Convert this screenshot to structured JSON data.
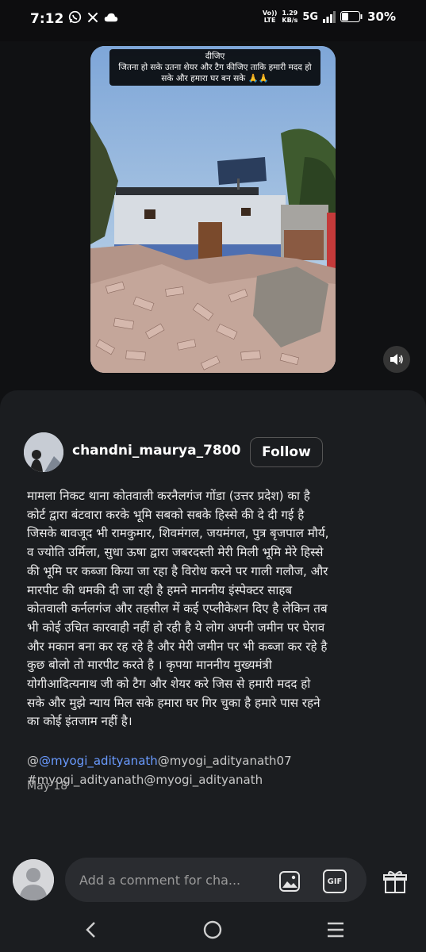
{
  "status_bar": {
    "time": "7:12",
    "network_top": "Vo))",
    "network_bottom": "LTE",
    "speed_top": "1.29",
    "speed_bottom": "KB/s",
    "network_type": "5G",
    "battery": "30%",
    "icons": [
      "whatsapp-icon",
      "x-icon",
      "cloud-icon",
      "signal-icon",
      "battery-icon"
    ]
  },
  "media": {
    "caption_line1": "दीजिए",
    "caption_line2": "जितना हो सके उतना शेयर और टैग कीजिए ताकि हमारी मदद हो",
    "caption_line3": "सके और हमारा घर बन सके 🙏🙏",
    "sound_icon": "speaker-icon"
  },
  "post": {
    "username": "chandni_maurya_7800",
    "follow_label": "Follow",
    "text_lines": [
      "मामला निकट थाना कोतवाली करनैलगंज गोंडा (उत्तर प्रदेश) का है",
      "कोर्ट द्वारा बंटवारा करके भूमि सबको सबके हिस्से की दे दी गई है",
      "जिसके बावजूद भी रामकुमार, शिवमंगल, जयमंगल, पुत्र बृजपाल मौर्य,",
      "व ज्योति उर्मिला, सुधा ऊषा द्वारा जबरदस्ती मेरी मिली भूमि मेरे हिस्से",
      "की भूमि पर कब्जा किया जा रहा है विरोध करने पर गाली गलौज, और",
      "मारपीट की धमकी दी जा रही है हमने माननीय इंस्पेक्टर साहब",
      "कोतवाली कर्नलगंज और तहसील में कई एप्लीकेशन दिए है लेकिन तब",
      "भी कोई उचित कारवाही नहीं हो रही है ये लोग अपनी जमीन पर घेराव",
      "और मकान बना कर रह रहे है और मेरी जमीन पर भी कब्जा कर रहे है",
      "कुछ बोलो तो मारपीट करते है । कृपया माननीय मुख्यमंत्री",
      "योगीआदित्यनाथ जी को टैग और शेयर करे जिस से हमारी मदद हो",
      "सके और मुझे न्याय मिल सके हमारा घर गिर चुका है हमारे पास रहने",
      "का कोई इंतजाम नहीं है।"
    ],
    "mention_1": "@myogi_adityanath",
    "mention_2": "myogi_adityanath07",
    "hashtag": "#myogi_adityanath",
    "mention_3": "myogi_adityanath",
    "date": "May 18"
  },
  "comment_bar": {
    "placeholder": "Add a comment for cha..."
  }
}
